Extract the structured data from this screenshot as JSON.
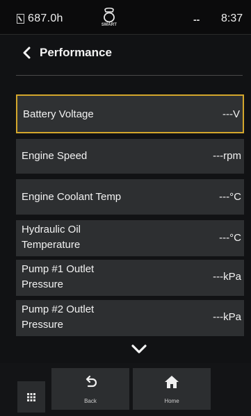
{
  "status_bar": {
    "hour_meter": "687.0h",
    "smart_label": "SMART",
    "connectivity": "--",
    "time": "8:37"
  },
  "header": {
    "title": "Performance"
  },
  "rows": [
    {
      "label": "Battery Voltage",
      "label_line2": "",
      "value": "---V"
    },
    {
      "label": "Engine Speed",
      "label_line2": "",
      "value": "---rpm"
    },
    {
      "label": "Engine Coolant Temp",
      "label_line2": "",
      "value": "---°C"
    },
    {
      "label": "Hydraulic Oil",
      "label_line2": "Temperature",
      "value": "---°C"
    },
    {
      "label": "Pump #1 Outlet",
      "label_line2": "Pressure",
      "value": "---kPa"
    },
    {
      "label": "Pump #2 Outlet",
      "label_line2": "Pressure",
      "value": "---kPa"
    }
  ],
  "bottom_nav": {
    "back_label": "Back",
    "home_label": "Home"
  },
  "icons": {
    "hour": "hour-meter-icon",
    "smart": "smart-icon",
    "back": "chevron-left-icon",
    "scroll": "chevron-down-icon",
    "menu": "grid-menu-icon",
    "back_nav": "undo-arrow-icon",
    "home": "home-icon"
  },
  "colors": {
    "background": "#111214",
    "row_background": "#2d2f31",
    "selection_border": "#d4a72c",
    "text": "#f2f2f2"
  }
}
